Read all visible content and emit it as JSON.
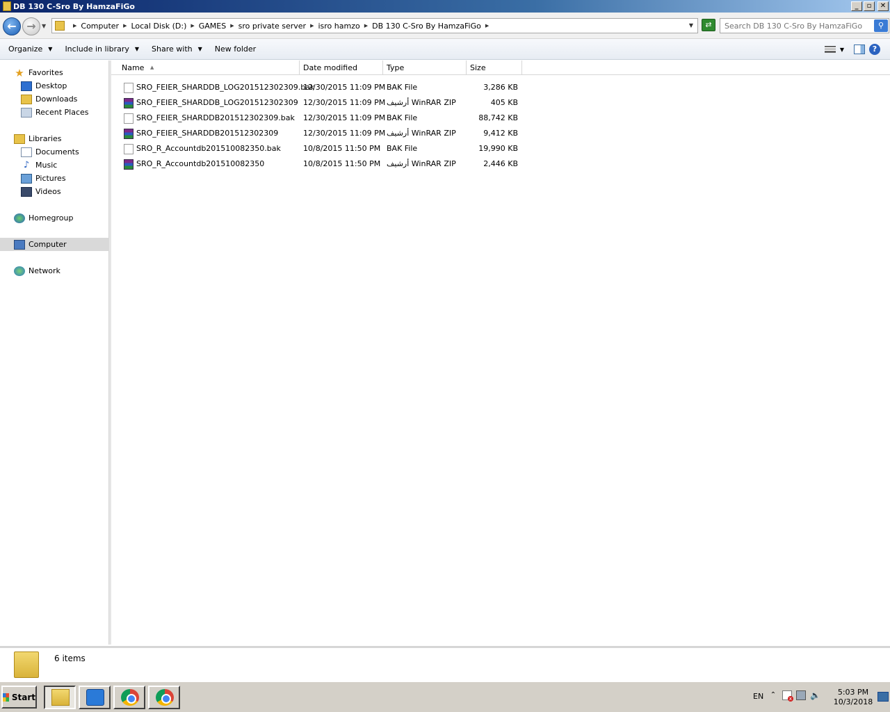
{
  "window": {
    "title": "DB 130 C-Sro By HamzaFiGo",
    "controls": {
      "minimize": "_",
      "maximize": "▫",
      "close": "✕"
    }
  },
  "address": {
    "crumbs": [
      "Computer",
      "Local Disk (D:)",
      "GAMES",
      "sro private server",
      "isro hamzo",
      "DB 130 C-Sro By HamzaFiGo"
    ],
    "search_placeholder": "Search DB 130 C-Sro By HamzaFiGo"
  },
  "toolbar": {
    "organize": "Organize",
    "include_in_library": "Include in library",
    "share_with": "Share with",
    "new_folder": "New folder",
    "help": "?"
  },
  "nav": {
    "favorites": "Favorites",
    "desktop": "Desktop",
    "downloads": "Downloads",
    "recent_places": "Recent Places",
    "libraries": "Libraries",
    "documents": "Documents",
    "music": "Music",
    "pictures": "Pictures",
    "videos": "Videos",
    "homegroup": "Homegroup",
    "computer": "Computer",
    "network": "Network"
  },
  "columns": {
    "name": "Name",
    "date": "Date modified",
    "type": "Type",
    "size": "Size"
  },
  "files": [
    {
      "name": "SRO_FEIER_SHARDDB_LOG201512302309.bak",
      "date": "12/30/2015 11:09 PM",
      "type": "BAK File",
      "size": "3,286 KB",
      "icon": "bak-file-icon"
    },
    {
      "name": "SRO_FEIER_SHARDDB_LOG201512302309",
      "date": "12/30/2015 11:09 PM",
      "type": "أرشيف WinRAR ZIP",
      "size": "405 KB",
      "icon": "winrar-archive-icon"
    },
    {
      "name": "SRO_FEIER_SHARDDB201512302309.bak",
      "date": "12/30/2015 11:09 PM",
      "type": "BAK File",
      "size": "88,742 KB",
      "icon": "bak-file-icon"
    },
    {
      "name": "SRO_FEIER_SHARDDB201512302309",
      "date": "12/30/2015 11:09 PM",
      "type": "أرشيف WinRAR ZIP",
      "size": "9,412 KB",
      "icon": "winrar-archive-icon"
    },
    {
      "name": "SRO_R_Accountdb201510082350.bak",
      "date": "10/8/2015 11:50 PM",
      "type": "BAK File",
      "size": "19,990 KB",
      "icon": "bak-file-icon"
    },
    {
      "name": "SRO_R_Accountdb201510082350",
      "date": "10/8/2015 11:50 PM",
      "type": "أرشيف WinRAR ZIP",
      "size": "2,446 KB",
      "icon": "winrar-archive-icon"
    }
  ],
  "status": {
    "item_count": "6 items"
  },
  "taskbar": {
    "start": "Start",
    "lang": "EN",
    "time": "5:03 PM",
    "date": "10/3/2018"
  }
}
